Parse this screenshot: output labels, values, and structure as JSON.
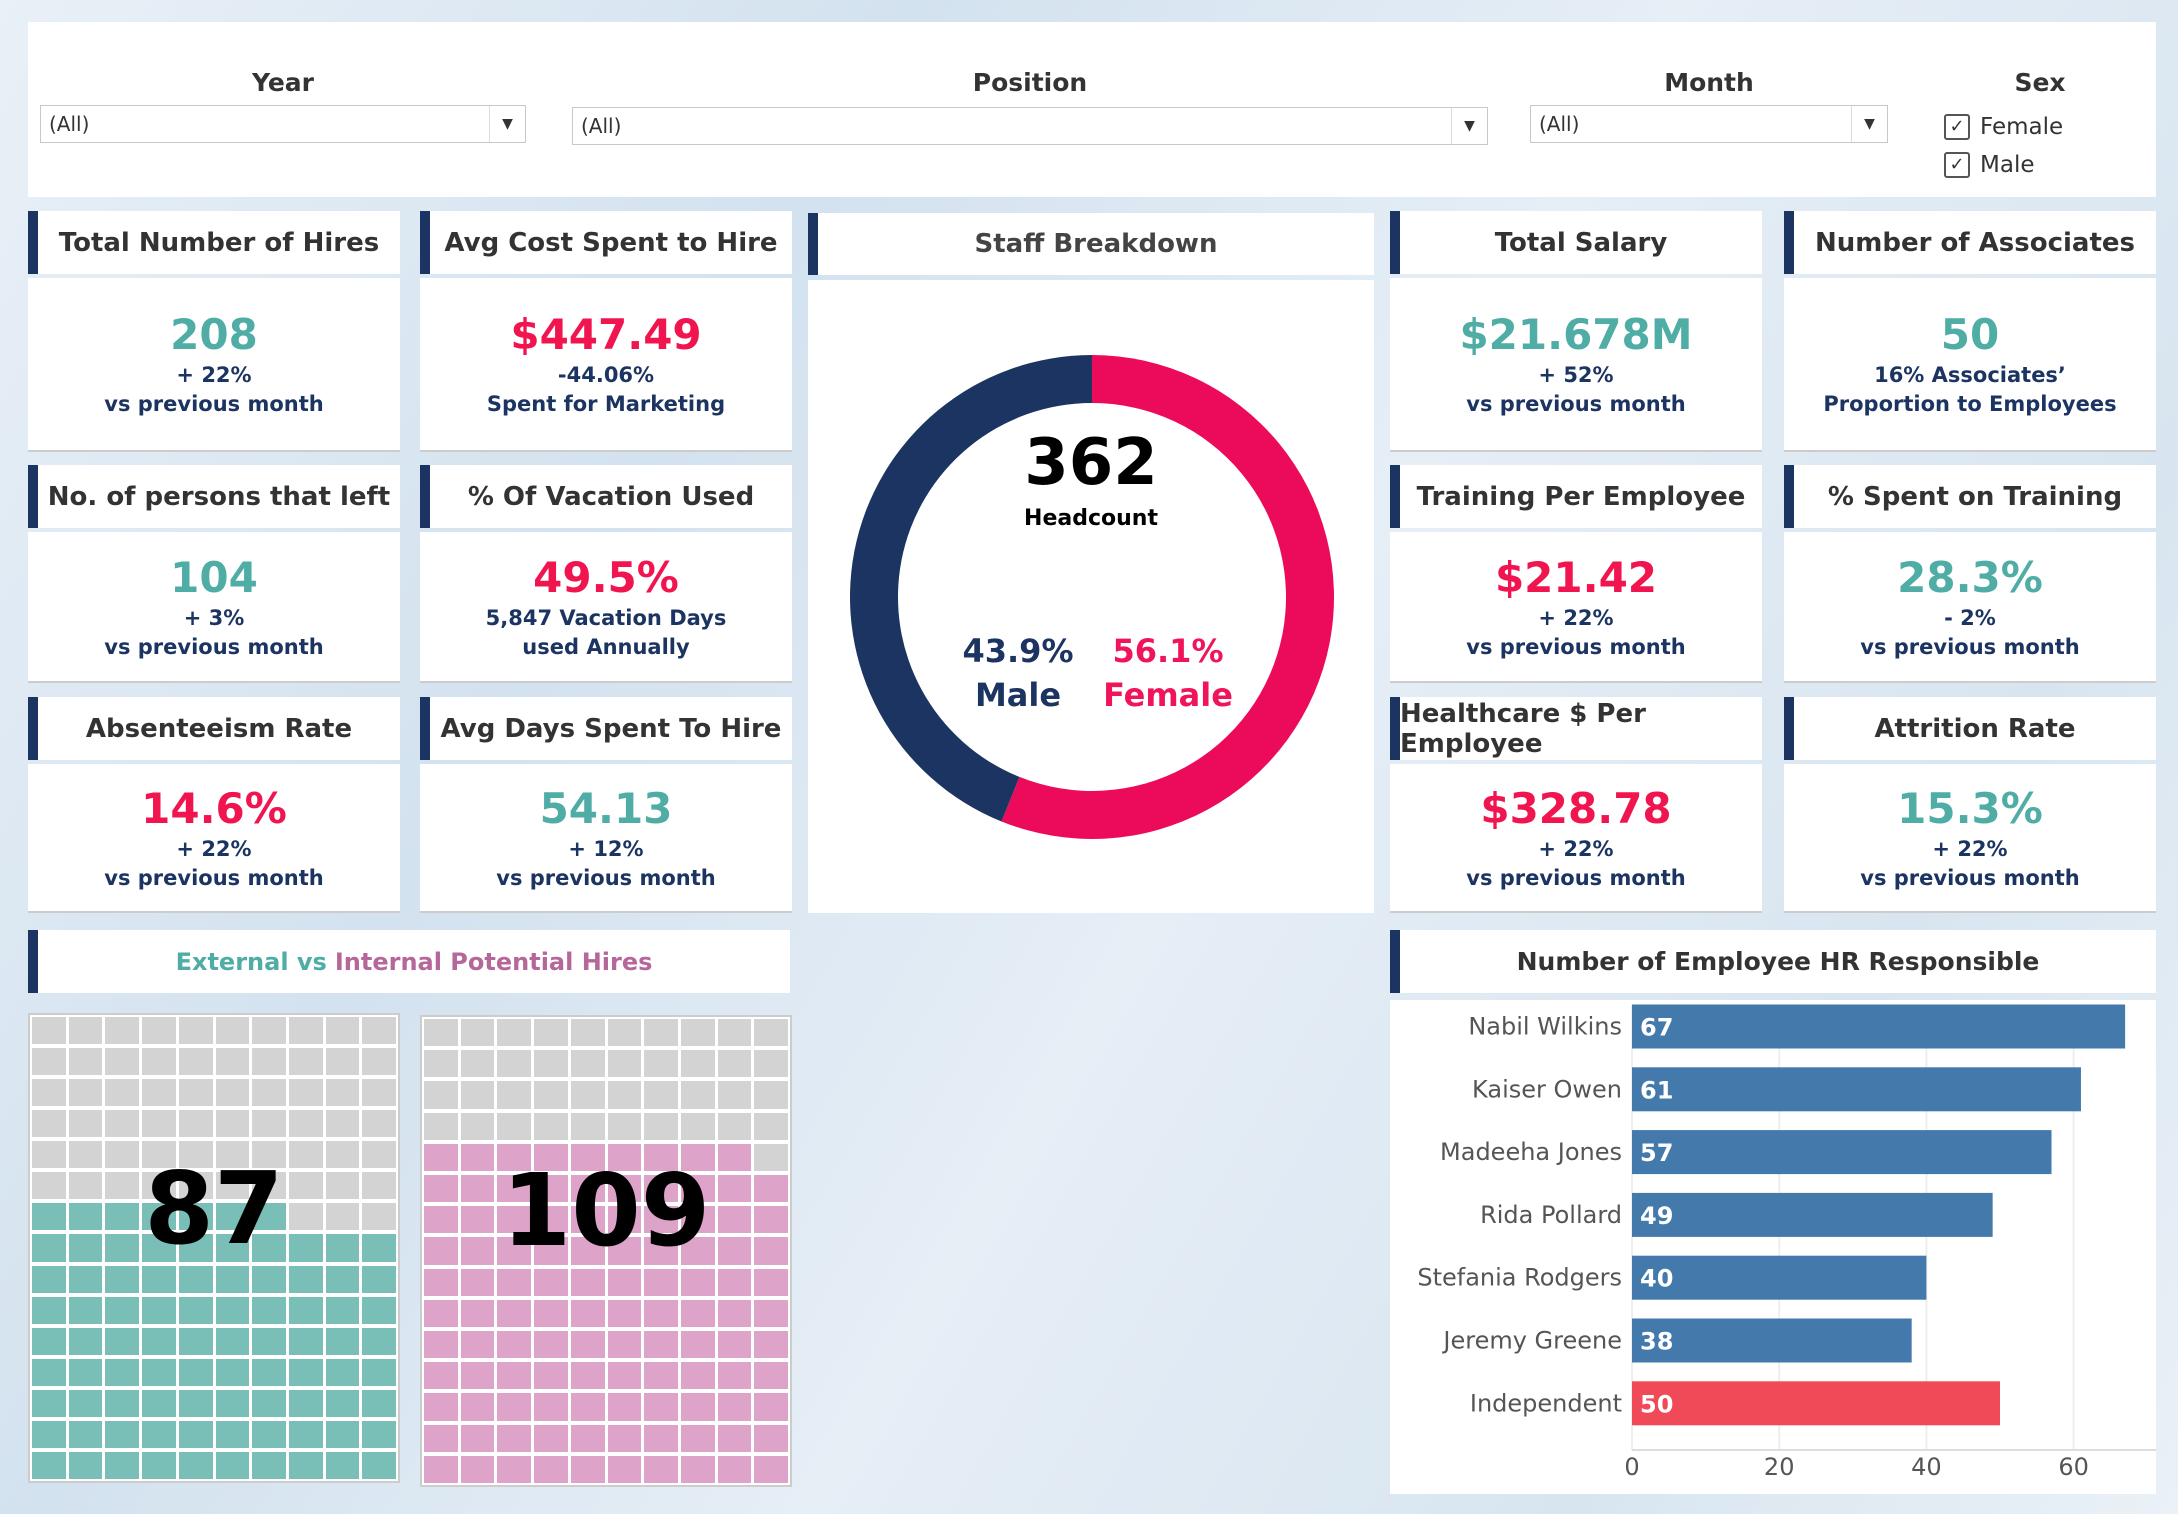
{
  "filters": {
    "year": {
      "label": "Year",
      "value": "(All)"
    },
    "position": {
      "label": "Position",
      "value": "(All)"
    },
    "month": {
      "label": "Month",
      "value": "(All)"
    },
    "sex": {
      "label": "Sex",
      "options": [
        {
          "label": "Female",
          "checked": true
        },
        {
          "label": "Male",
          "checked": true
        }
      ]
    }
  },
  "colors": {
    "teal": "#4fada6",
    "red": "#f0144f",
    "navy": "#1c3461",
    "bar": "#4479ab",
    "bar_highlight": "#f04a58",
    "waffle_external": "#7abfb7",
    "waffle_internal": "#dea3c9",
    "waffle_empty": "#d3d3d3"
  },
  "kpis": [
    {
      "title": "Total Number of Hires",
      "value": "208",
      "color": "teal",
      "line1": "+ 22%",
      "line2": "vs previous month"
    },
    {
      "title": "Avg Cost Spent to Hire",
      "value": "$447.49",
      "color": "red",
      "line1": "-44.06%",
      "line2": "Spent for Marketing"
    },
    {
      "title": "Total Salary",
      "value": "$21.678M",
      "color": "teal",
      "line1": "+ 52%",
      "line2": "vs previous month"
    },
    {
      "title": "Number of Associates",
      "value": "50",
      "color": "teal",
      "line1": "16% Associates’",
      "line2": "Proportion to Employees"
    },
    {
      "title": "No. of persons that left",
      "value": "104",
      "color": "teal",
      "line1": "+ 3%",
      "line2": "vs previous month"
    },
    {
      "title": "% Of Vacation Used",
      "value": "49.5%",
      "color": "red",
      "line1": "5,847 Vacation Days",
      "line2": "used Annually"
    },
    {
      "title": "Training Per Employee",
      "value": "$21.42",
      "color": "red",
      "line1": "+ 22%",
      "line2": "vs previous month"
    },
    {
      "title": "% Spent on Training",
      "value": "28.3%",
      "color": "teal",
      "line1": "- 2%",
      "line2": "vs previous month"
    },
    {
      "title": "Absenteeism Rate",
      "value": "14.6%",
      "color": "red",
      "line1": "+ 22%",
      "line2": "vs previous month"
    },
    {
      "title": "Avg Days Spent To Hire",
      "value": "54.13",
      "color": "teal",
      "line1": "+ 12%",
      "line2": "vs previous month"
    },
    {
      "title": "Healthcare $ Per Employee",
      "value": "$328.78",
      "color": "red",
      "line1": "+ 22%",
      "line2": "vs previous month"
    },
    {
      "title": "Attrition Rate",
      "value": "15.3%",
      "color": "teal",
      "line1": "+ 22%",
      "line2": "vs previous month"
    }
  ],
  "staff": {
    "title": "Staff Breakdown",
    "headcount": "362",
    "headcount_label": "Headcount",
    "male_pct": "43.9%",
    "male_label": "Male",
    "female_pct": "56.1%",
    "female_label": "Female"
  },
  "waffle": {
    "title_part1": "External vs ",
    "title_part2": "Internal Potential Hires",
    "external": 87,
    "internal": 109,
    "cells": 150
  },
  "chart_data": {
    "type": "bar",
    "title": "Number of Employee HR Responsible",
    "categories": [
      "Nabil Wilkins",
      "Kaiser Owen",
      "Madeeha Jones",
      "Rida Pollard",
      "Stefania Rodgers",
      "Jeremy Greene",
      "Independent"
    ],
    "values": [
      67,
      61,
      57,
      49,
      40,
      38,
      50
    ],
    "highlight": "Independent",
    "xticks": [
      "0",
      "20",
      "40",
      "60"
    ],
    "xlim": [
      0,
      70
    ],
    "grid": true
  }
}
